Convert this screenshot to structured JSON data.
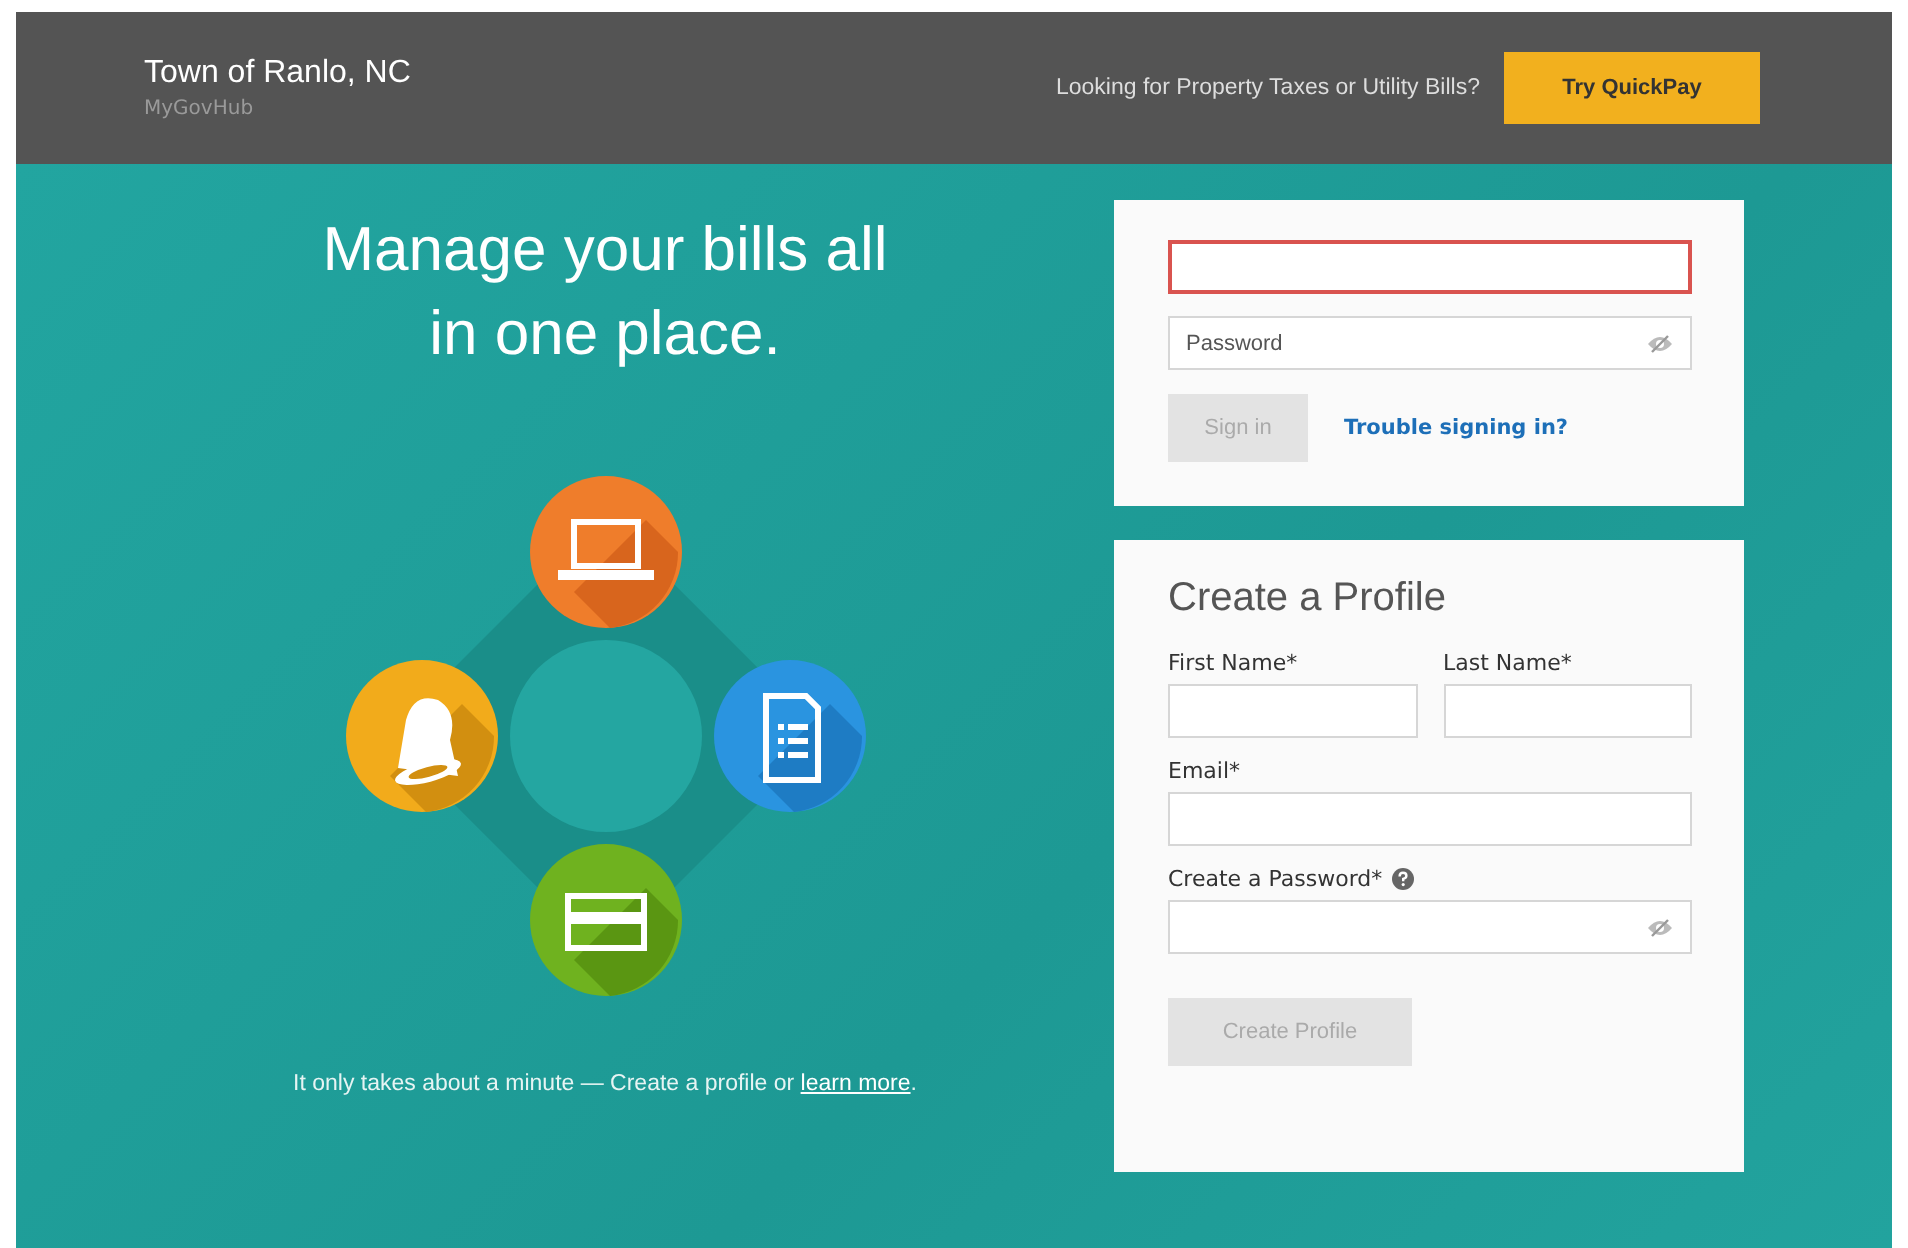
{
  "header": {
    "title": "Town of Ranlo, NC",
    "subtitle": "MyGovHub",
    "prompt": "Looking for Property Taxes or Utility Bills?",
    "quickpay_button": "Try QuickPay"
  },
  "hero": {
    "headline": "Manage your bills all in one place.",
    "footer_text": "It only takes about a minute — Create a profile or ",
    "footer_link": "learn more",
    "footer_end": "."
  },
  "login": {
    "email_field": {
      "focused": true
    },
    "password_field": {
      "placeholder": "Password"
    },
    "sign_in_button": {
      "label": "Sign in",
      "disabled": true
    },
    "trouble_link": "Trouble signing in?"
  },
  "profile": {
    "title": "Create a Profile",
    "fields": [
      {
        "label": "First Name*",
        "kind": "half"
      },
      {
        "label": "Last Name*",
        "kind": "half"
      },
      {
        "label": "Email*",
        "kind": "full"
      },
      {
        "label": "Create a Password*",
        "kind": "secret"
      }
    ],
    "create_button": {
      "label": "Create Profile",
      "disabled": true
    }
  }
}
